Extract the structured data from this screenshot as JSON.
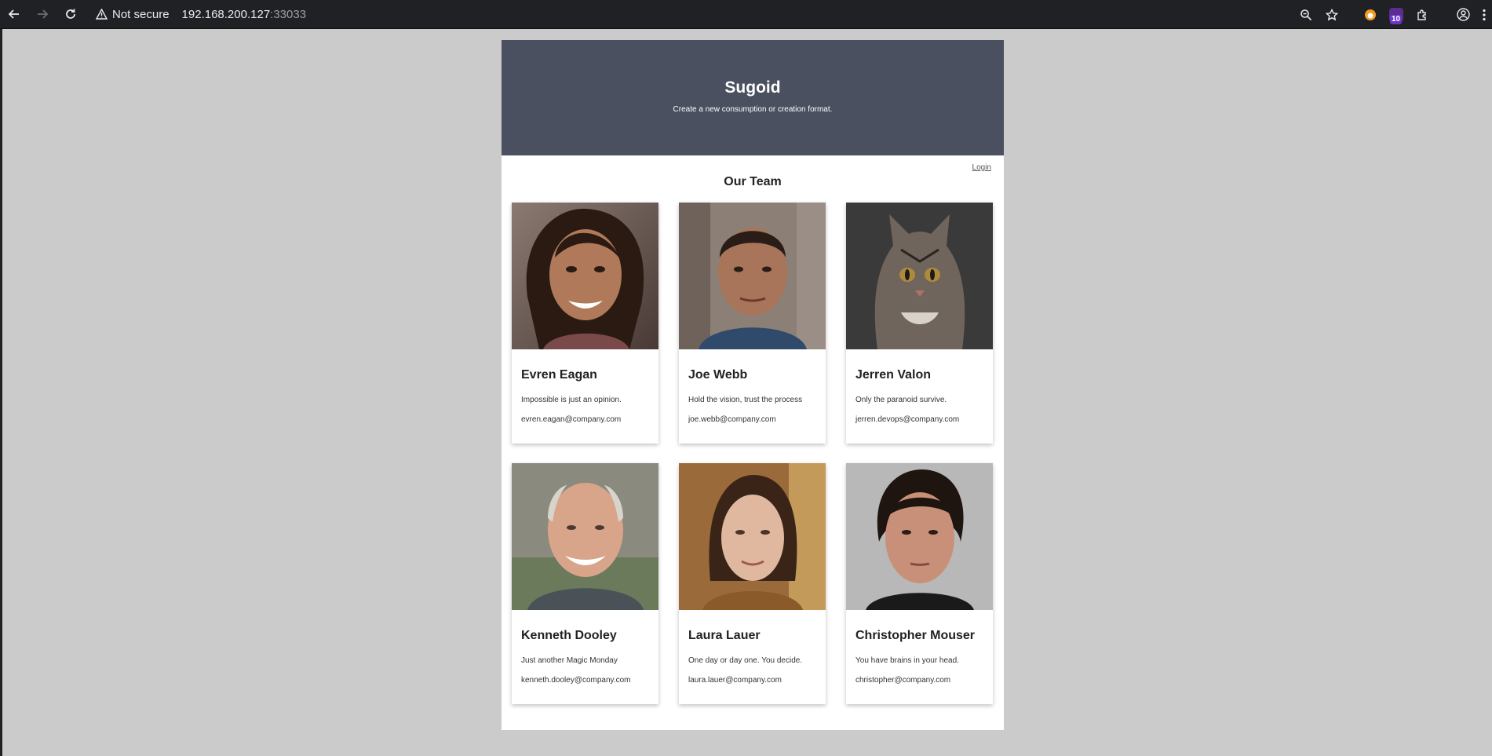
{
  "browser": {
    "security_label": "Not secure",
    "url_host": "192.168.200.127",
    "url_port": ":33033",
    "extension_badge": "10"
  },
  "site": {
    "title": "Sugoid",
    "tagline": "Create a new consumption or creation format.",
    "login_label": "Login",
    "section_title": "Our Team"
  },
  "team": [
    {
      "name": "Evren Eagan",
      "quote": "Impossible is just an opinion.",
      "email": "evren.eagan@company.com"
    },
    {
      "name": "Joe Webb",
      "quote": "Hold the vision, trust the process",
      "email": "joe.webb@company.com"
    },
    {
      "name": "Jerren Valon",
      "quote": "Only the paranoid survive.",
      "email": "jerren.devops@company.com"
    },
    {
      "name": "Kenneth Dooley",
      "quote": "Just another Magic Monday",
      "email": "kenneth.dooley@company.com"
    },
    {
      "name": "Laura Lauer",
      "quote": "One day or day one. You decide.",
      "email": "laura.lauer@company.com"
    },
    {
      "name": "Christopher Mouser",
      "quote": "You have brains in your head.",
      "email": "christopher@company.com"
    }
  ]
}
